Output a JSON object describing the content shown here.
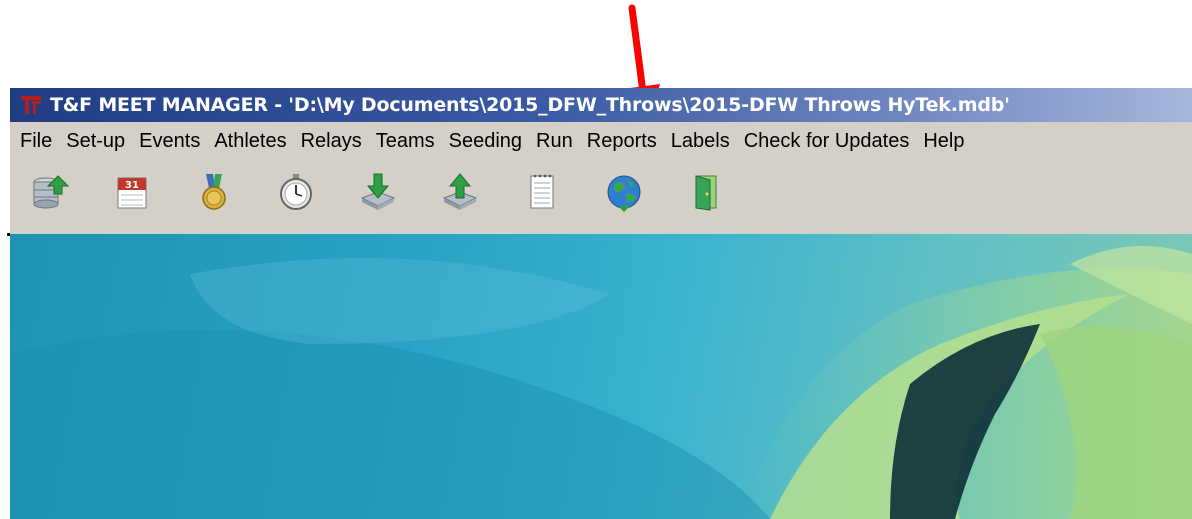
{
  "window": {
    "title": "T&F MEET MANAGER - 'D:\\My Documents\\2015_DFW_Throws\\2015-DFW Throws HyTek.mdb'"
  },
  "menu": {
    "items": [
      {
        "label": "File"
      },
      {
        "label": "Set-up"
      },
      {
        "label": "Events"
      },
      {
        "label": "Athletes"
      },
      {
        "label": "Relays"
      },
      {
        "label": "Teams"
      },
      {
        "label": "Seeding"
      },
      {
        "label": "Run"
      },
      {
        "label": "Reports"
      },
      {
        "label": "Labels"
      },
      {
        "label": "Check for Updates"
      },
      {
        "label": "Help"
      }
    ]
  },
  "toolbar": {
    "buttons": [
      {
        "icon": "database-upload-icon"
      },
      {
        "icon": "calendar-icon",
        "text": "31"
      },
      {
        "icon": "medal-icon"
      },
      {
        "icon": "stopwatch-icon"
      },
      {
        "icon": "import-icon"
      },
      {
        "icon": "export-icon"
      },
      {
        "icon": "notepad-icon"
      },
      {
        "icon": "globe-icon"
      },
      {
        "icon": "exit-door-icon"
      }
    ]
  },
  "colors": {
    "title_bar_start": "#203d84",
    "menu_background": "#d4d0c8",
    "annotation_arrow": "#ff0000",
    "content_background": "#2aa3c6"
  }
}
